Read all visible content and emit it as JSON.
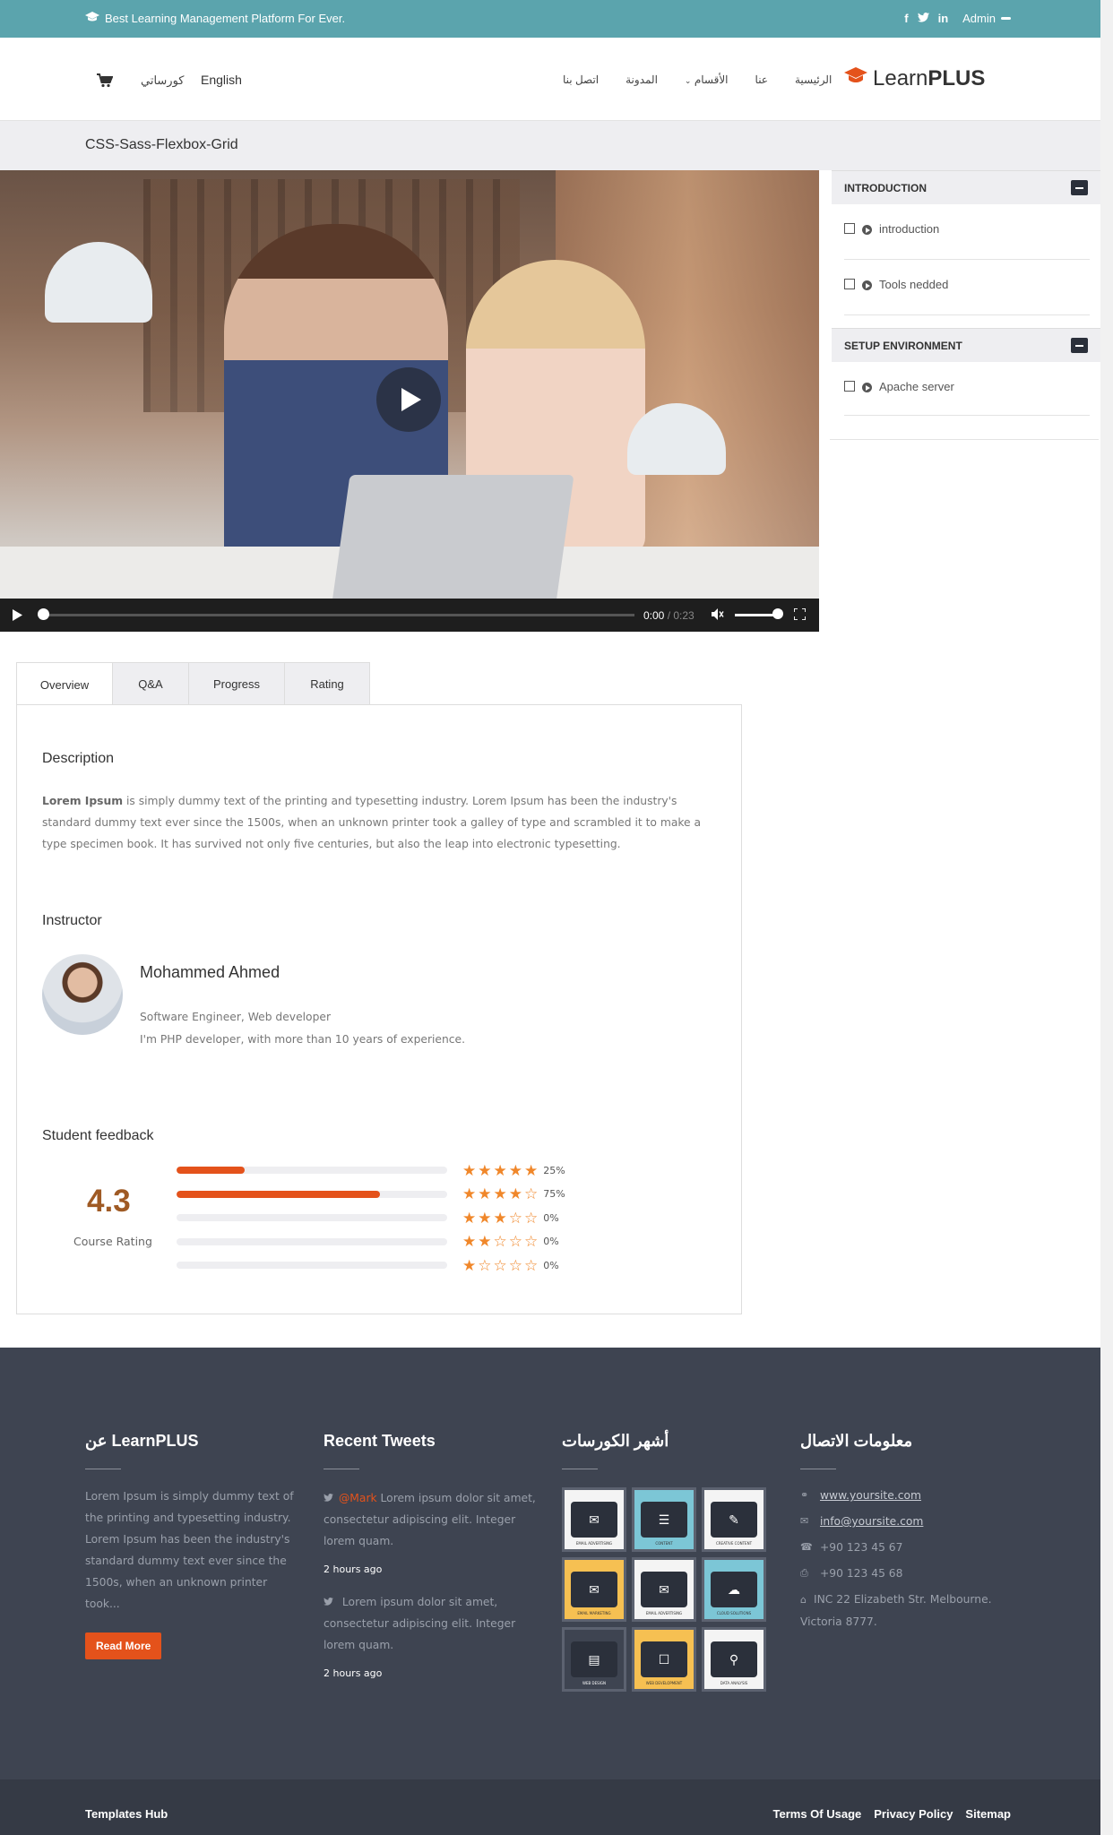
{
  "topbar": {
    "tagline": "Best Learning Management Platform For Ever.",
    "social": [
      "f",
      "t",
      "in"
    ],
    "user": "Admin"
  },
  "header": {
    "lang_ar": "كورساتي",
    "lang_en": "English",
    "nav": [
      "الرئيسية",
      "عنا",
      "الأقسام",
      "المدونة",
      "اتصل بنا"
    ],
    "logo_light": "Learn",
    "logo_bold": "PLUS",
    "accent": "#e4521b"
  },
  "course": {
    "title": "CSS-Sass-Flexbox-Grid"
  },
  "player": {
    "current": "0:00",
    "duration": "/ 0:23",
    "progress": 0.0,
    "volume": 0.8
  },
  "curriculum": [
    {
      "title": "INTRODUCTION",
      "lessons": [
        "introduction",
        "Tools nedded"
      ]
    },
    {
      "title": "SETUP ENVIRONMENT",
      "lessons": [
        "Apache server"
      ]
    }
  ],
  "tabs": [
    "Overview",
    "Q&A",
    "Progress",
    "Rating"
  ],
  "overview": {
    "desc_title": "Description",
    "desc_bold": "Lorem Ipsum",
    "desc_text": " is simply dummy text of the printing and typesetting industry. Lorem Ipsum has been the industry's standard dummy text ever since the 1500s, when an unknown printer took a galley of type and scrambled it to make a type specimen book. It has survived not only five centuries, but also the leap into electronic typesetting.",
    "instructor_title": "Instructor",
    "instructor_name": "Mohammed Ahmed",
    "instructor_role": "Software Engineer, Web developer",
    "instructor_bio": "I'm PHP developer, with more than 10 years of experience.",
    "feedback_title": "Student feedback",
    "rating": "4.3",
    "rating_label": "Course Rating",
    "breakdown": [
      {
        "stars": 5,
        "fill": 0.25,
        "pct": "25%"
      },
      {
        "stars": 4,
        "fill": 0.75,
        "pct": "75%"
      },
      {
        "stars": 3,
        "fill": 0,
        "pct": "0%"
      },
      {
        "stars": 2,
        "fill": 0,
        "pct": "0%"
      },
      {
        "stars": 1,
        "fill": 0,
        "pct": "0%"
      }
    ]
  },
  "footer": {
    "about_title": "عن LearnPLUS",
    "about_text": "Lorem Ipsum is simply dummy text of the printing and typesetting industry. Lorem Ipsum has been the industry's standard dummy text ever since the 1500s, when an unknown printer took...",
    "read_more": "Read More",
    "tweets_title": "Recent Tweets",
    "tweets": [
      {
        "handle": "@Mark",
        "text": " Lorem ipsum dolor sit amet, consectetur adipiscing elit. Integer lorem quam.",
        "ago": "2 hours ago"
      },
      {
        "handle": "",
        "text": " Lorem ipsum dolor sit amet, consectetur adipiscing elit. Integer lorem quam.",
        "ago": "2 hours ago"
      }
    ],
    "courses_title": "أشهر الكورسات",
    "course_tiles": [
      {
        "bg": "#f4f4f4",
        "cap": "EMAIL ADVERTISING"
      },
      {
        "bg": "#7cc6d6",
        "cap": "CONTENT"
      },
      {
        "bg": "#f4f4f4",
        "cap": "CREATIVE CONTENT"
      },
      {
        "bg": "#f6c052",
        "cap": "EMAIL MARKETING"
      },
      {
        "bg": "#f4f4f4",
        "cap": "EMAIL ADVERTISING"
      },
      {
        "bg": "#7cc6d6",
        "cap": "CLOUD SOLUTIONS"
      },
      {
        "bg": "#3e4451",
        "cap": "WEB DESIGN"
      },
      {
        "bg": "#f6c052",
        "cap": "WEB DEVELOPMENT"
      },
      {
        "bg": "#f4f4f4",
        "cap": "DATA ANALYSIS"
      }
    ],
    "contact_title": "معلومات الاتصال",
    "website": "www.yoursite.com",
    "email": "info@yoursite.com",
    "phone": "+90 123 45 67",
    "fax": "+90 123 45 68",
    "address": "INC 22 Elizabeth Str. Melbourne. Victoria 8777."
  },
  "bottom": {
    "brand": "Templates Hub",
    "links": [
      "Terms Of Usage",
      "Privacy Policy",
      "Sitemap"
    ]
  }
}
